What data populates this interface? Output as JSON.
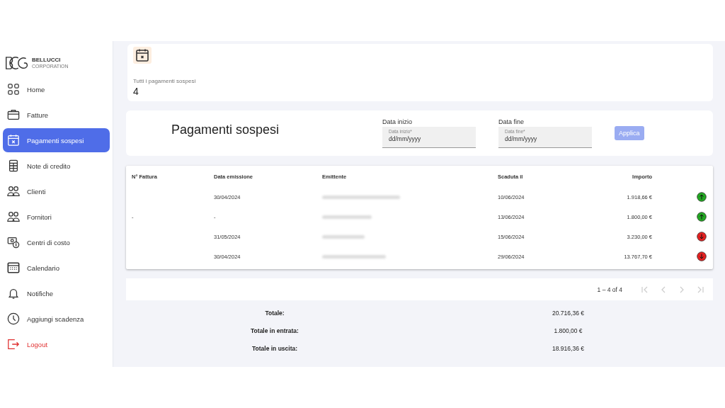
{
  "logo": {
    "name": "BELLUCCI",
    "tagline": "CORPORATION"
  },
  "sidebar": {
    "items": [
      {
        "label": "Home",
        "selected": false
      },
      {
        "label": "Fatture",
        "selected": false
      },
      {
        "label": "Pagamenti sospesi",
        "selected": true
      },
      {
        "label": "Note di credito",
        "selected": false
      },
      {
        "label": "Clienti",
        "selected": false
      },
      {
        "label": "Fornitori",
        "selected": false
      },
      {
        "label": "Centri di costo",
        "selected": false
      },
      {
        "label": "Calendario",
        "selected": false
      },
      {
        "label": "Notifiche",
        "selected": false
      },
      {
        "label": "Aggiungi scadenza",
        "selected": false
      },
      {
        "label": "Logout",
        "selected": false,
        "kind": "danger"
      }
    ]
  },
  "summary": {
    "label": "Tutti i pagamenti sospesi",
    "count": "4"
  },
  "filters": {
    "title": "Pagamenti sospesi",
    "fields": [
      {
        "label": "Data inizio",
        "float_label": "Data inizio*",
        "value": "dd/mm/yyyy"
      },
      {
        "label": "Data fine",
        "float_label": "Data fine*",
        "value": "dd/mm/yyyy"
      }
    ],
    "apply": {
      "label": "Applica",
      "disabled": true
    }
  },
  "table": {
    "columns": [
      "N° Fattura",
      "Data emissione",
      "Emittente",
      "Scaduta il",
      "Importo"
    ],
    "rows": [
      {
        "issued": "30/04/2024",
        "due": "10/06/2024",
        "amount": "1.918,66 €",
        "kind": "in"
      },
      {
        "number": "-",
        "issued": "-",
        "due": "13/06/2024",
        "amount": "1.800,00 €",
        "kind": "in"
      },
      {
        "issued": "31/05/2024",
        "due": "15/06/2024",
        "amount": "3.230,00 €",
        "kind": "out"
      },
      {
        "issued": "30/04/2024",
        "due": "29/06/2024",
        "amount": "13.767,70 €",
        "kind": "out"
      }
    ]
  },
  "paginator": {
    "range": "1 – 4 of 4"
  },
  "totals": [
    {
      "label": "Totale:",
      "value": "20.716,36 €"
    },
    {
      "label": "Totale in entrata:",
      "value": "1.800,00 €"
    },
    {
      "label": "Totale in uscita:",
      "value": "18.916,36 €"
    }
  ]
}
